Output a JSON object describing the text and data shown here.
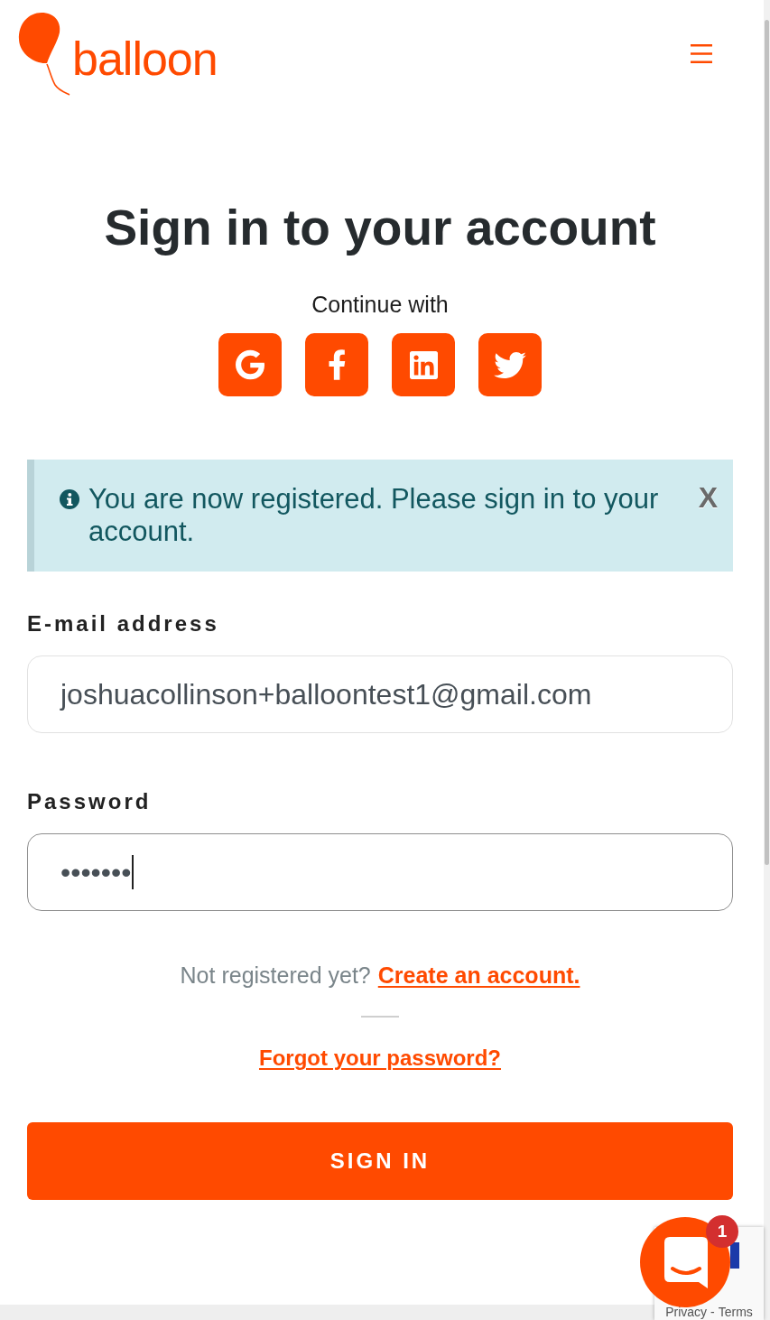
{
  "header": {
    "logo_text": "balloon"
  },
  "title": "Sign in to your account",
  "social": {
    "prompt": "Continue with",
    "providers": [
      {
        "kind": "google"
      },
      {
        "kind": "facebook"
      },
      {
        "kind": "linkedin"
      },
      {
        "kind": "twitter"
      }
    ]
  },
  "alert": {
    "message": "You are now registered. Please sign in to your account.",
    "close": "X"
  },
  "form": {
    "fields": [
      {
        "label": "E-mail address",
        "value": "joshuacollinson+balloontest1@gmail.com",
        "focused": false
      },
      {
        "label": "Password",
        "value": "•••••••",
        "focused": true
      }
    ],
    "register_prompt": "Not registered yet?",
    "register_link": "Create an account.",
    "forgot_link": "Forgot your password?",
    "submit": "SIGN IN"
  },
  "chat": {
    "badge": "1"
  },
  "recaptcha": {
    "privacy": "Privacy",
    "separator": "-",
    "terms": "Terms"
  }
}
